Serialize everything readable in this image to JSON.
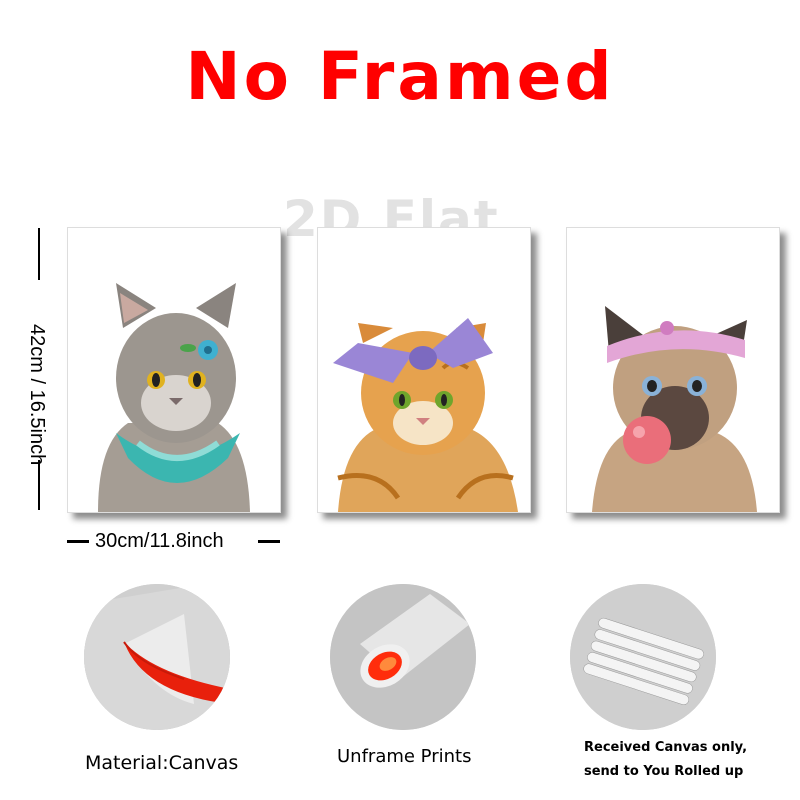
{
  "title": "No Framed",
  "watermark": "2D Flat",
  "dimensions": {
    "height_label": "42cm / 16.5inch",
    "width_label": "30cm/11.8inch"
  },
  "features": [
    {
      "label": "Material:Canvas"
    },
    {
      "label": "Unframe  Prints"
    },
    {
      "label_line1": "Received Canvas only,",
      "label_line2": "send to You Rolled up"
    }
  ],
  "colors": {
    "title": "#ff0000",
    "canvas_backing": "#e8200c"
  }
}
